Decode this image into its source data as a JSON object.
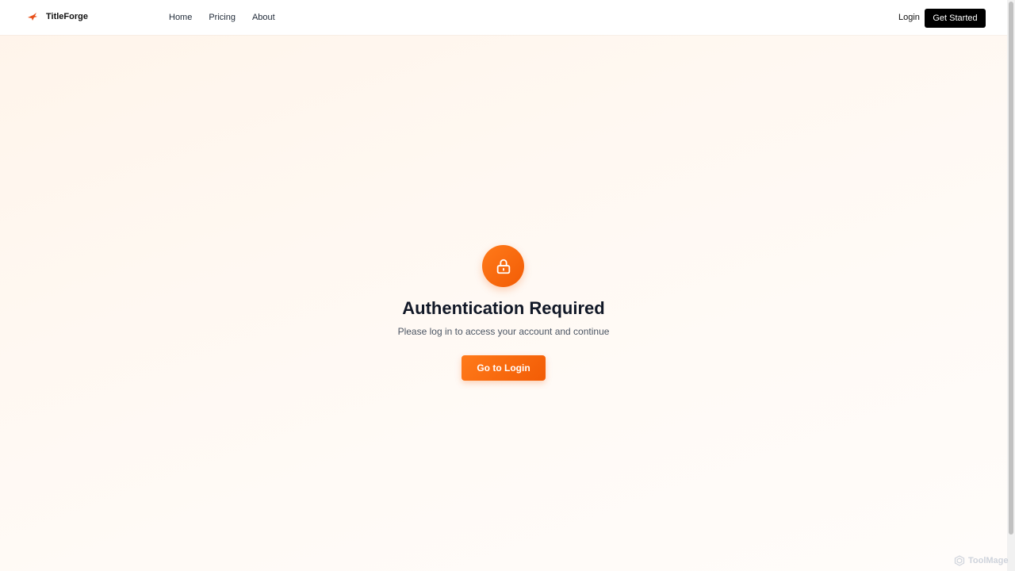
{
  "header": {
    "brand_name": "TitleForge",
    "brand_icon": "bird-icon",
    "nav": [
      {
        "label": "Home"
      },
      {
        "label": "Pricing"
      },
      {
        "label": "About"
      }
    ],
    "login_label": "Login",
    "cta_label": "Get Started"
  },
  "auth": {
    "icon": "lock-icon",
    "title": "Authentication Required",
    "message": "Please log in to access your account and continue",
    "button_label": "Go to Login"
  },
  "watermark": {
    "text": "ToolMage"
  },
  "colors": {
    "accent": "#f76a0c",
    "cta_background": "#000000",
    "page_background": "#fff6ee"
  }
}
